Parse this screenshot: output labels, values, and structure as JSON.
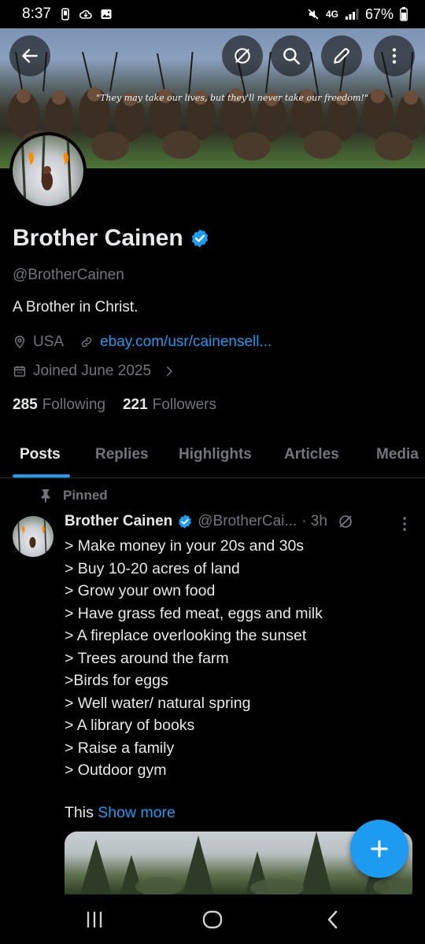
{
  "status_bar": {
    "time": "8:37",
    "network": "4G",
    "battery": "67%"
  },
  "banner": {
    "quote": "\"They may take our lives, but they'll never take our freedom!\""
  },
  "profile": {
    "name": "Brother Cainen",
    "handle": "@BrotherCainen",
    "bio": "A Brother in Christ.",
    "location": "USA",
    "website": "ebay.com/usr/cainensell...",
    "joined": "Joined June 2025",
    "following_count": "285",
    "following_label": "Following",
    "followers_count": "221",
    "followers_label": "Followers"
  },
  "tabs": [
    {
      "label": "Posts",
      "active": true
    },
    {
      "label": "Replies",
      "active": false
    },
    {
      "label": "Highlights",
      "active": false
    },
    {
      "label": "Articles",
      "active": false
    },
    {
      "label": "Media",
      "active": false
    }
  ],
  "post": {
    "pinned_label": "Pinned",
    "author": "Brother Cainen",
    "handle": "@BrotherCai...",
    "time": "· 3h",
    "lines": [
      "> Make money in your 20s and 30s",
      "> Buy 10-20 acres of land",
      "> Grow your own food",
      "> Have grass fed meat, eggs and milk",
      "> A fireplace overlooking the sunset",
      "> Trees around the farm",
      ">Birds for eggs",
      "> Well water/ natural spring",
      "> A library of books",
      "> Raise a family",
      "> Outdoor gym"
    ],
    "tail_text": "This",
    "show_more": "Show more"
  },
  "colors": {
    "accent": "#1d9bf0",
    "muted": "#71767b",
    "text": "#e7e9ea",
    "background": "#000000",
    "divider": "#2f3336"
  }
}
